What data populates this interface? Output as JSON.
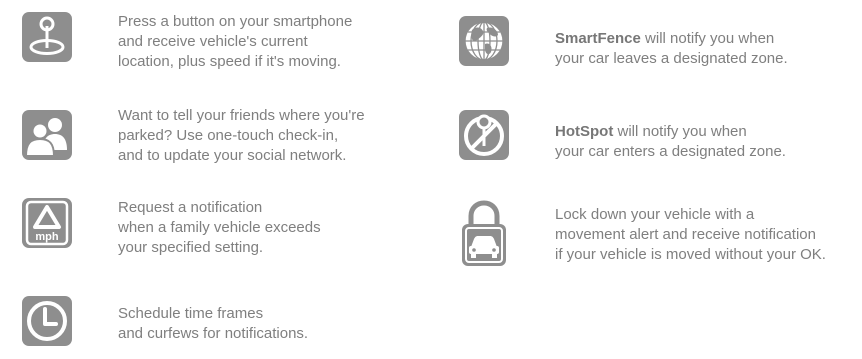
{
  "colors": {
    "icon_bg": "#8e8e8e",
    "icon_fg": "#ffffff",
    "text": "#7f7f7f"
  },
  "features": [
    {
      "icon": "map-pin-icon",
      "lines": [
        "Press a button on your smartphone",
        "and receive vehicle's current",
        "location, plus speed if it's moving."
      ]
    },
    {
      "icon": "people-icon",
      "lines": [
        "Want to tell your friends where you're",
        "parked? Use one-touch check-in,",
        "and to update your social network."
      ]
    },
    {
      "icon": "speed-alert-icon",
      "icon_label": "mph",
      "lines": [
        "Request a notification",
        "when a family vehicle exceeds",
        "your specified setting."
      ]
    },
    {
      "icon": "clock-icon",
      "lines": [
        "Schedule time frames",
        "and curfews for notifications."
      ]
    },
    {
      "icon": "globe-icon",
      "name": "SmartFence",
      "lines": [
        " will notify you when",
        "your car leaves a designated zone."
      ]
    },
    {
      "icon": "hotspot-pin-icon",
      "name": "HotSpot",
      "lines": [
        " will notify you when",
        "your car enters a designated zone."
      ]
    },
    {
      "icon": "lock-car-icon",
      "lines": [
        "Lock down your vehicle with a",
        "movement alert and receive notification",
        "if your vehicle is moved without your OK."
      ]
    }
  ]
}
